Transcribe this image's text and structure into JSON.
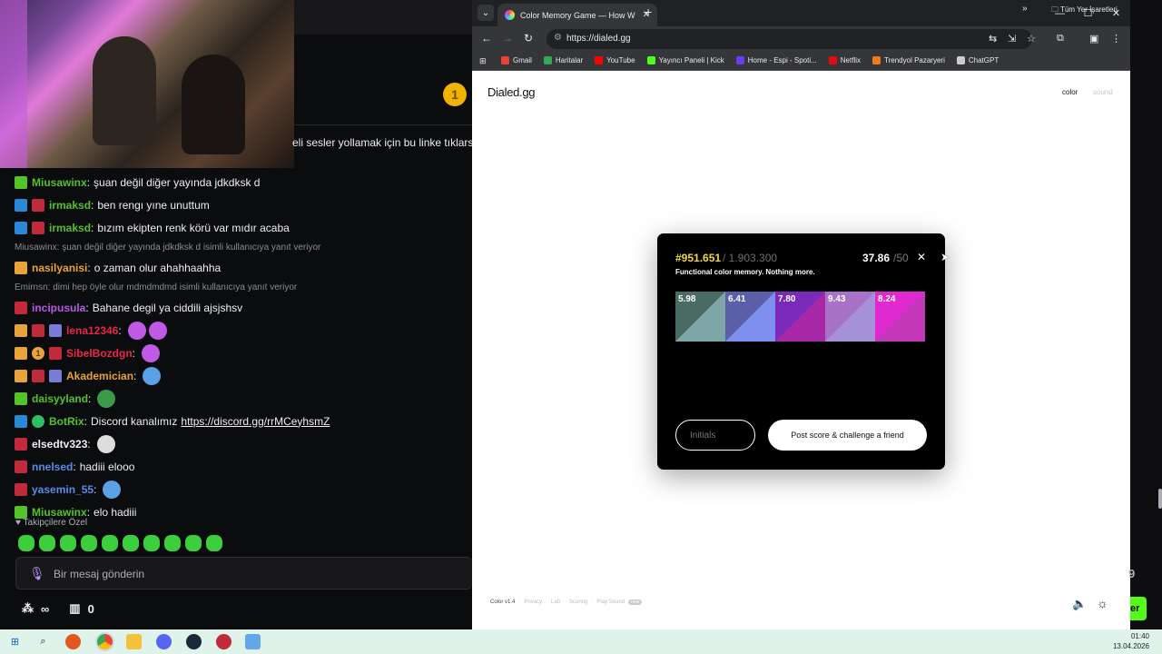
{
  "stream": {
    "banner_text": "eli sesler yollamak için bu linke tıklarsın",
    "gold_badge": "1"
  },
  "chat": {
    "messages": [
      {
        "kind": "msg",
        "badges": [
          "b-sub"
        ],
        "user": "Miusawinx",
        "user_color": "#53c22b",
        "text": "şuan değil diğer yayında jdkdksk d"
      },
      {
        "kind": "msg",
        "badges": [
          "b-mod",
          "b-fol"
        ],
        "user": "irmaksd",
        "user_color": "#53c22b",
        "text": "ben rengı yıne unuttum"
      },
      {
        "kind": "msg",
        "badges": [
          "b-mod",
          "b-fol"
        ],
        "user": "irmaksd",
        "user_color": "#53c22b",
        "text": "bızım ekipten renk körü var mıdır acaba"
      },
      {
        "kind": "reply",
        "text": "Miusawinx: şuan değil diğer yayında jdkdksk d isimli kullanıcıya yanıt veriyor"
      },
      {
        "kind": "msg",
        "badges": [
          "b-crown"
        ],
        "user": "nasilyanisi",
        "user_color": "#e8a33b",
        "text": "o zaman olur ahahhaahha"
      },
      {
        "kind": "reply",
        "text": "Emirnsn: dimi hep öyle olur mdmdmdmd isimli kullanıcıya yanıt veriyor"
      },
      {
        "kind": "msg",
        "badges": [
          "b-fol"
        ],
        "user": "incipusula",
        "user_color": "#b85ae6",
        "text": "Bahane degil ya ciddili ajsjshsv"
      },
      {
        "kind": "msg",
        "badges": [
          "b-crown",
          "b-fol",
          "b-gift"
        ],
        "user": "lena12346",
        "user_color": "#e8264a",
        "text": "",
        "emotes": [
          "#c05ae6",
          "#c05ae6"
        ]
      },
      {
        "kind": "msg",
        "badges": [
          "b-crown",
          "b-one",
          "b-fol"
        ],
        "user": "SibelBozdgn",
        "user_color": "#e8264a",
        "text": "",
        "emotes": [
          "#c05ae6"
        ]
      },
      {
        "kind": "msg",
        "badges": [
          "b-crown",
          "b-fol",
          "b-gift"
        ],
        "user": "Akademician",
        "user_color": "#e8a33b",
        "text": "",
        "emotes": [
          "#5aa0e6"
        ]
      },
      {
        "kind": "msg",
        "badges": [
          "b-sub"
        ],
        "user": "daisyyland",
        "user_color": "#53c22b",
        "text": "",
        "emotes": [
          "#3a9a4a"
        ]
      },
      {
        "kind": "msg",
        "badges": [
          "b-mod",
          "b-green"
        ],
        "user": "BotRix",
        "user_color": "#53c22b",
        "text": "Discord kanalımız",
        "link": "https://discord.gg/rrMCeyhsmZ"
      },
      {
        "kind": "msg",
        "badges": [
          "b-fol"
        ],
        "user": "elsedtv323",
        "user_color": "#efeff1",
        "text": "",
        "emotes": [
          "#dddddd"
        ]
      },
      {
        "kind": "msg",
        "badges": [
          "b-fol"
        ],
        "user": "nnelsed",
        "user_color": "#5a8ae6",
        "text": "hadiii elooo"
      },
      {
        "kind": "msg",
        "badges": [
          "b-fol"
        ],
        "user": "yasemin_55",
        "user_color": "#5a8ae6",
        "text": "",
        "emotes": [
          "#5aa0e6"
        ]
      },
      {
        "kind": "msg",
        "badges": [
          "b-sub"
        ],
        "user": "Miusawinx",
        "user_color": "#53c22b",
        "text": "elo hadiii"
      }
    ],
    "followers_label": "Takipçilere Özel",
    "input_placeholder": "Bir mesaj gönderin",
    "bottom_count": "0",
    "infinity": "∞"
  },
  "browser": {
    "tab_title": "Color Memory Game — How W",
    "url": "https://dialed.gg",
    "bookmarks": [
      {
        "label": "Gmail",
        "color": "#ea4335"
      },
      {
        "label": "Haritalar",
        "color": "#34a853"
      },
      {
        "label": "YouTube",
        "color": "#ff0000"
      },
      {
        "label": "Yayıncı Paneli | Kick",
        "color": "#53fc18"
      },
      {
        "label": "Home - Espi - Spoti...",
        "color": "#6a3df0"
      },
      {
        "label": "Netflix",
        "color": "#e50914"
      },
      {
        "label": "Trendyol Pazaryeri",
        "color": "#f27a1a"
      },
      {
        "label": "ChatGPT",
        "color": "#cccccc"
      }
    ],
    "all_bookmarks": "Tüm Yer İşaretleri"
  },
  "site": {
    "logo": "Dialed.gg",
    "nav_color": "color",
    "nav_sound": "sound",
    "card": {
      "hex_score": "#951.651",
      "hex_total": "/ 1.903.300",
      "tagline": "Functional color memory. Nothing more.",
      "total_score": "37.86",
      "total_max": "/50",
      "swatches": [
        {
          "value": "5.98",
          "target": "#4a6a64",
          "guess": "#7ea6a6"
        },
        {
          "value": "6.41",
          "target": "#5a5fa8",
          "guess": "#7f8ff0"
        },
        {
          "value": "7.80",
          "target": "#7a2ab8",
          "guess": "#a828a8"
        },
        {
          "value": "9.43",
          "target": "#a872c8",
          "guess": "#a690d6"
        },
        {
          "value": "8.24",
          "target": "#e02ad0",
          "guess": "#c238b8"
        }
      ],
      "initials_placeholder": "Initials",
      "post_button": "Post score & challenge a friend"
    },
    "footer": {
      "version": "Color v1.4",
      "privacy": "Privacy",
      "lab": "Lab",
      "scoring": "Scoring",
      "play_sound": "Play Sound",
      "new_badge": "new"
    }
  },
  "taskbar": {
    "time": "01:40",
    "date": "13.04.2026"
  },
  "right_strip": {
    "number": "9",
    "green_text": "er"
  }
}
